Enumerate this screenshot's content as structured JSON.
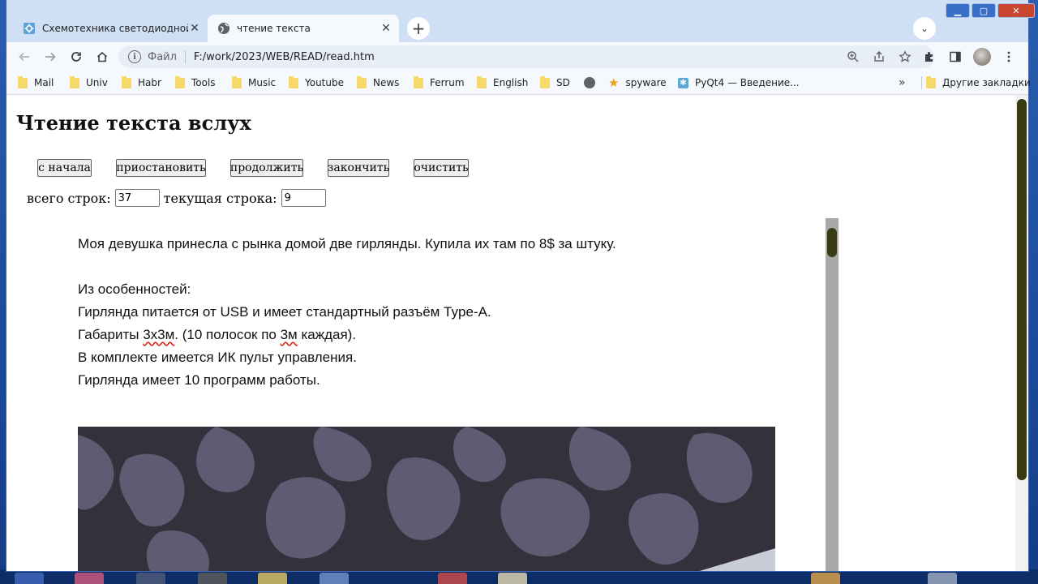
{
  "browser": {
    "tabs": [
      {
        "title": "Схемотехника светодиодной де",
        "active": false
      },
      {
        "title": "чтение текста",
        "active": true
      }
    ],
    "new_tab_symbol": "+",
    "tab_search_symbol": "⌄",
    "window_controls": {
      "minimize": "▁",
      "maximize": "▢",
      "close": "✕"
    },
    "address": {
      "scheme_label": "Файл",
      "url": "F:/work/2023/WEB/READ/read.htm"
    },
    "bookmarks": [
      {
        "label": "Mail",
        "icon": "folder-icon"
      },
      {
        "label": "Univ",
        "icon": "folder-icon"
      },
      {
        "label": "Habr",
        "icon": "folder-icon"
      },
      {
        "label": "Tools",
        "icon": "folder-icon"
      },
      {
        "label": "Music",
        "icon": "folder-icon"
      },
      {
        "label": "Youtube",
        "icon": "folder-icon"
      },
      {
        "label": "News",
        "icon": "folder-icon"
      },
      {
        "label": "Ferrum",
        "icon": "folder-icon"
      },
      {
        "label": "English",
        "icon": "folder-icon"
      },
      {
        "label": "SD",
        "icon": "folder-icon"
      },
      {
        "label": "",
        "icon": "globe-icon"
      },
      {
        "label": "spyware",
        "icon": "star-icon"
      },
      {
        "label": "PyQt4 — Введение...",
        "icon": "pyqt-icon"
      }
    ],
    "bookmarks_overflow": "»",
    "other_bookmarks": "Другие закладки"
  },
  "page": {
    "title": "Чтение текста вслух",
    "buttons": {
      "from_start": "с начала",
      "pause": "приостановить",
      "resume": "продолжить",
      "finish": "закончить",
      "clear": "очистить"
    },
    "counters": {
      "total_label": "всего строк:",
      "total_value": "37",
      "current_label": "текущая строка:",
      "current_value": "9"
    },
    "text": {
      "line1": "Моя девушка принесла с рынка домой две гирлянды. Купила их там по 8$ за штуку.",
      "line3": "Из особенностей:",
      "line4": "Гирлянда питается от USB и имеет стандартный разъём Type-A.",
      "line5_a": "Габариты ",
      "line5_b": "3х3м",
      "line5_c": ". (10 полосок по ",
      "line5_d": "3м",
      "line5_e": " каждая).",
      "line6": "В комплекте имеется ИК пульт управления.",
      "line7": "Гирлянда имеет 10 программ работы."
    }
  },
  "colors": {
    "tab_strip": "#cfe0f5",
    "toolbar": "#f5f8fd",
    "scroll_thumb": "#3a3a14",
    "desktop": "#1f4e9e"
  }
}
